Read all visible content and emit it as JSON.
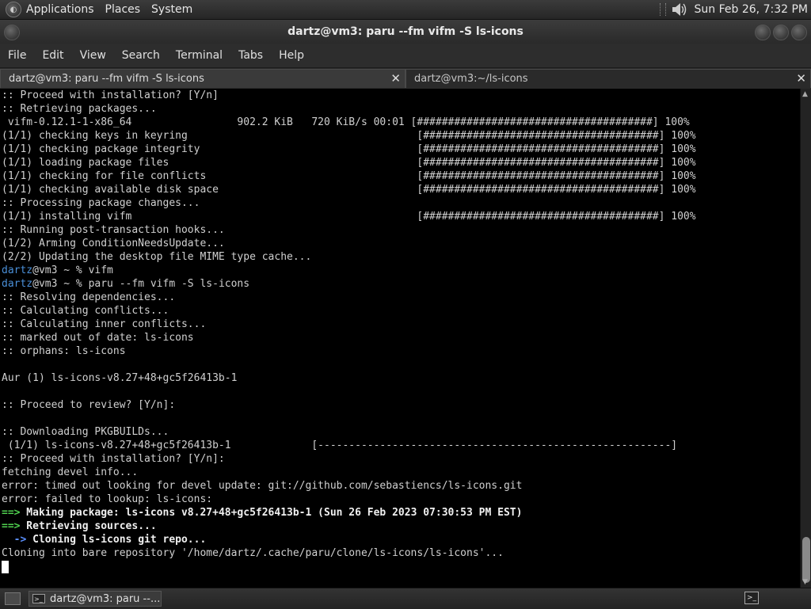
{
  "top_panel": {
    "menu": [
      "Applications",
      "Places",
      "System"
    ],
    "clock": "Sun Feb 26,  7:32 PM"
  },
  "window": {
    "title": "dartz@vm3: paru --fm vifm -S ls-icons"
  },
  "menubar": [
    "File",
    "Edit",
    "View",
    "Search",
    "Terminal",
    "Tabs",
    "Help"
  ],
  "tabs": [
    {
      "label": "dartz@vm3: paru --fm vifm -S ls-icons",
      "active": true
    },
    {
      "label": "dartz@vm3:~/ls-icons",
      "active": false
    }
  ],
  "terminal": {
    "lines": [
      {
        "text": ":: Proceed with installation? [Y/n]"
      },
      {
        "text": ":: Retrieving packages..."
      },
      {
        "text": " vifm-0.12.1-1-x86_64                 902.2 KiB   720 KiB/s 00:01 [######################################] 100%"
      },
      {
        "text": "(1/1) checking keys in keyring                                     [######################################] 100%"
      },
      {
        "text": "(1/1) checking package integrity                                   [######################################] 100%"
      },
      {
        "text": "(1/1) loading package files                                        [######################################] 100%"
      },
      {
        "text": "(1/1) checking for file conflicts                                  [######################################] 100%"
      },
      {
        "text": "(1/1) checking available disk space                                [######################################] 100%"
      },
      {
        "text": ":: Processing package changes..."
      },
      {
        "text": "(1/1) installing vifm                                              [######################################] 100%"
      },
      {
        "text": ":: Running post-transaction hooks..."
      },
      {
        "text": "(1/2) Arming ConditionNeedsUpdate..."
      },
      {
        "text": "(2/2) Updating the desktop file MIME type cache..."
      },
      {
        "prompt": true,
        "user": "dartz",
        "rest": "@vm3 ~ % vifm"
      },
      {
        "prompt": true,
        "user": "dartz",
        "rest": "@vm3 ~ % paru --fm vifm -S ls-icons"
      },
      {
        "text": ":: Resolving dependencies..."
      },
      {
        "text": ":: Calculating conflicts..."
      },
      {
        "text": ":: Calculating inner conflicts..."
      },
      {
        "text": ":: marked out of date: ls-icons"
      },
      {
        "text": ":: orphans: ls-icons"
      },
      {
        "text": ""
      },
      {
        "text": "Aur (1) ls-icons-v8.27+48+gc5f26413b-1"
      },
      {
        "text": ""
      },
      {
        "text": ":: Proceed to review? [Y/n]:"
      },
      {
        "text": ""
      },
      {
        "text": ":: Downloading PKGBUILDs..."
      },
      {
        "text": " (1/1) ls-icons-v8.27+48+gc5f26413b-1             [---------------------------------------------------------]"
      },
      {
        "text": ":: Proceed with installation? [Y/n]:"
      },
      {
        "text": "fetching devel info..."
      },
      {
        "text": "error: timed out looking for devel update: git://github.com/sebastiencs/ls-icons.git"
      },
      {
        "text": "error: failed to lookup: ls-icons:"
      },
      {
        "arrow": "==>",
        "arrow_color": "green",
        "bold": " Making package: ls-icons v8.27+48+gc5f26413b-1 (Sun 26 Feb 2023 07:30:53 PM EST)"
      },
      {
        "arrow": "==>",
        "arrow_color": "green",
        "bold": " Retrieving sources..."
      },
      {
        "arrow": "  ->",
        "arrow_color": "blue",
        "bold": " Cloning ls-icons git repo..."
      },
      {
        "text": "Cloning into bare repository '/home/dartz/.cache/paru/clone/ls-icons/ls-icons'..."
      },
      {
        "cursor": true
      }
    ]
  },
  "taskbar": {
    "items": [
      {
        "label": "dartz@vm3: paru --..."
      }
    ]
  },
  "colors": {
    "terminal_bg": "#000000",
    "prompt_user": "#4a8fd8",
    "arrow_green": "#4fd14f",
    "arrow_blue": "#5a8fff"
  }
}
